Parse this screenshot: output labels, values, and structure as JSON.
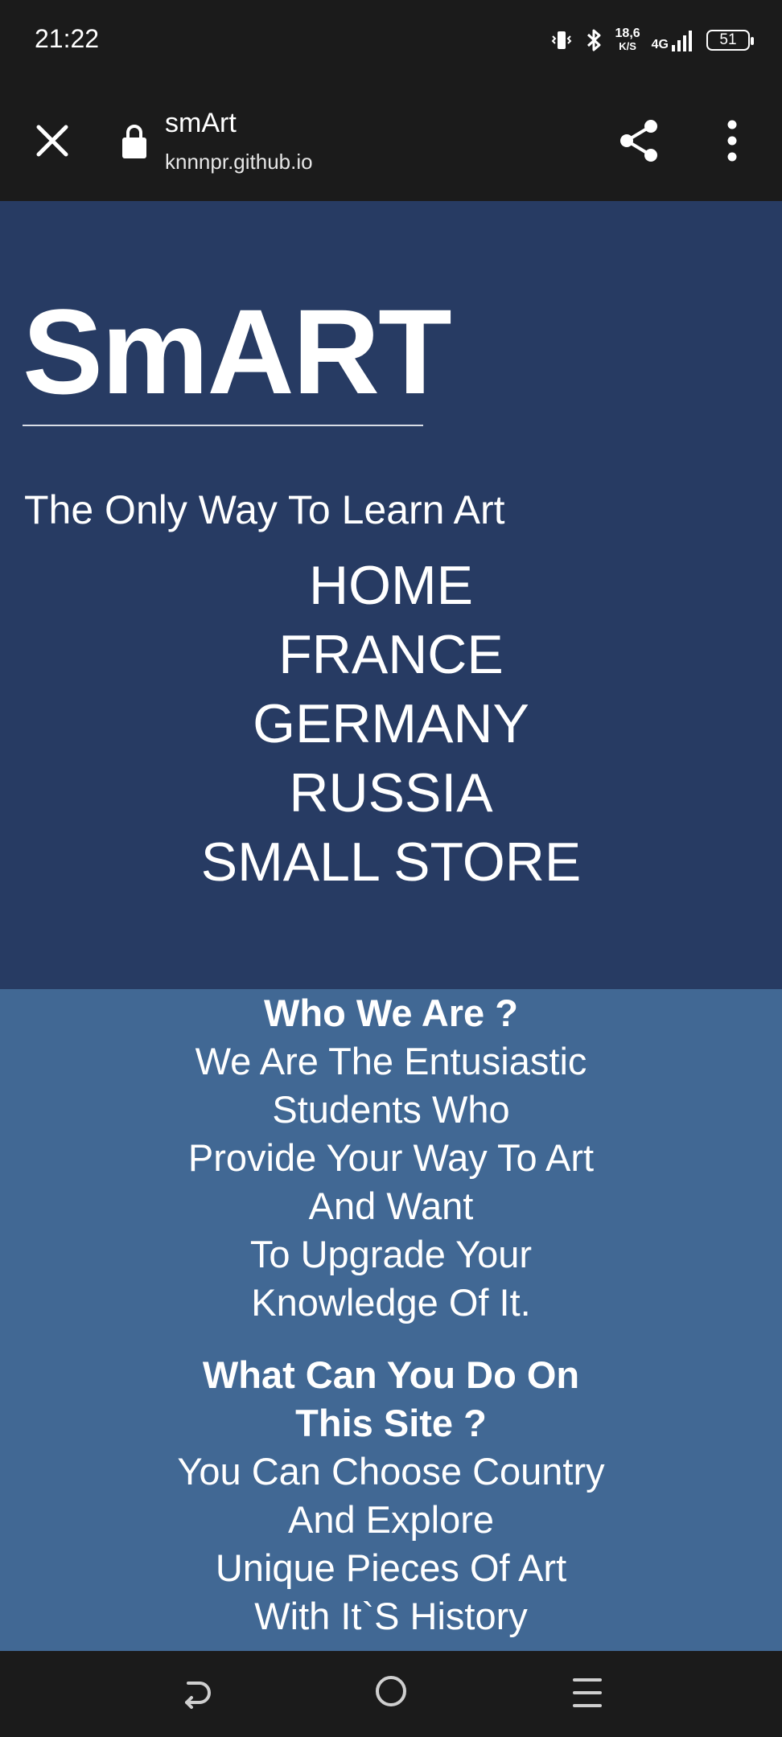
{
  "status_bar": {
    "time": "21:22",
    "net_speed_value": "18,6",
    "net_speed_unit": "K/S",
    "network_type": "4G",
    "battery": "51",
    "icons": [
      "vibrate-icon",
      "bluetooth-icon",
      "signal-icon",
      "battery-icon"
    ]
  },
  "toolbar": {
    "title": "smArt",
    "url": "knnnpr.github.io",
    "icons": [
      "close-icon",
      "lock-icon",
      "share-icon",
      "more-vert-icon"
    ]
  },
  "hero": {
    "logo": "SmART",
    "tagline": "The Only Way To Learn Art",
    "nav": [
      "HOME",
      "FRANCE",
      "GERMANY",
      "RUSSIA",
      "SMALL STORE"
    ]
  },
  "about": {
    "who_heading": "Who We Are ?",
    "who_lines": [
      "We Are The Entusiastic",
      "Students Who",
      "Provide Your Way To Art",
      "And Want",
      "To Upgrade Your",
      "Knowledge Of It."
    ],
    "what_heading_lines": [
      "What Can You Do On",
      "This Site ?"
    ],
    "what_lines": [
      "You Can Choose Country",
      "And Explore",
      "Unique Pieces Of Art",
      "With It`S History"
    ]
  },
  "colors": {
    "hero_bg": "#273b63",
    "about_bg": "#416894",
    "chrome_bg": "#1b1b1b"
  }
}
